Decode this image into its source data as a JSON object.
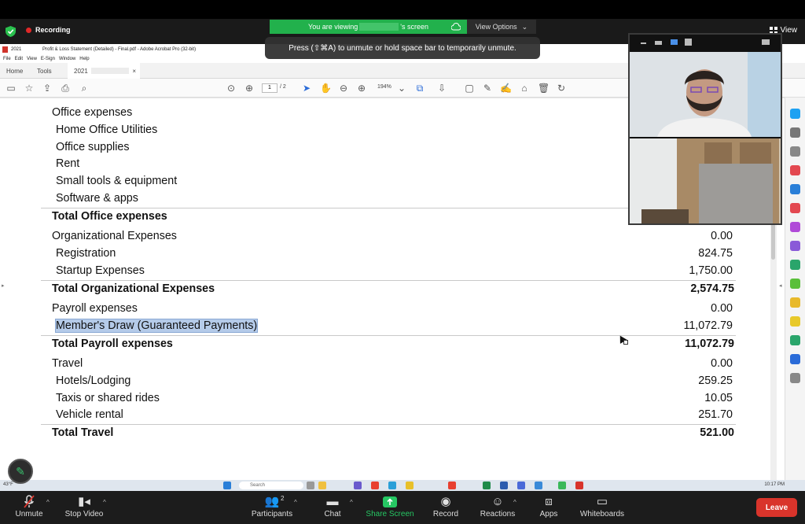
{
  "zoom_top": {
    "recording_label": "Recording",
    "viewing_prefix": "You are viewing",
    "viewing_suffix": "'s screen",
    "view_options_label": "View Options",
    "view_label": "View",
    "unmute_hint": "Press  (⇧⌘A) to unmute or hold space bar to temporarily unmute."
  },
  "acrobat": {
    "window_year": "2021",
    "window_title": "Profit & Loss Statement (Detailed) - Final.pdf - Adobe Acrobat Pro (32-bit)",
    "menu": [
      "File",
      "Edit",
      "View",
      "E-Sign",
      "Window",
      "Help"
    ],
    "tab_home": "Home",
    "tab_tools": "Tools",
    "tab_doc": "2021",
    "tab_close": "×",
    "page_current": "1",
    "page_total": "/ 2",
    "zoom_percent": "194%"
  },
  "statement": {
    "rows": [
      {
        "label": "Office expenses",
        "amount": "",
        "type": "header"
      },
      {
        "label": "Home Office Utilities",
        "amount": "",
        "type": "item"
      },
      {
        "label": "Office supplies",
        "amount": "",
        "type": "item"
      },
      {
        "label": "Rent",
        "amount": "",
        "type": "item"
      },
      {
        "label": "Small tools & equipment",
        "amount": "",
        "type": "item"
      },
      {
        "label": "Software & apps",
        "amount": "",
        "type": "item"
      },
      {
        "label": "Total Office expenses",
        "amount": "",
        "type": "total"
      },
      {
        "label": "Organizational Expenses",
        "amount": "0.00",
        "type": "header"
      },
      {
        "label": "Registration",
        "amount": "824.75",
        "type": "item"
      },
      {
        "label": "Startup Expenses",
        "amount": "1,750.00",
        "type": "item"
      },
      {
        "label": "Total Organizational Expenses",
        "amount": "2,574.75",
        "type": "total"
      },
      {
        "label": "Payroll expenses",
        "amount": "0.00",
        "type": "header"
      },
      {
        "label": "Member's Draw (Guaranteed Payments)",
        "amount": "11,072.79",
        "type": "item",
        "highlighted": true
      },
      {
        "label": "Total Payroll expenses",
        "amount": "11,072.79",
        "type": "total"
      },
      {
        "label": "Travel",
        "amount": "0.00",
        "type": "header"
      },
      {
        "label": "Hotels/Lodging",
        "amount": "259.25",
        "type": "item"
      },
      {
        "label": "Taxis or shared rides",
        "amount": "10.05",
        "type": "item"
      },
      {
        "label": "Vehicle rental",
        "amount": "251.70",
        "type": "item"
      },
      {
        "label": "Total Travel",
        "amount": "521.00",
        "type": "total"
      }
    ]
  },
  "taskbar": {
    "temperature": "43°F",
    "search_placeholder": "Search",
    "clock": "10:17 PM"
  },
  "controls": {
    "unmute": "Unmute",
    "stop_video": "Stop Video",
    "participants": "Participants",
    "participants_count": "2",
    "chat": "Chat",
    "share_screen": "Share Screen",
    "record": "Record",
    "reactions": "Reactions",
    "apps": "Apps",
    "whiteboards": "Whiteboards",
    "leave": "Leave"
  },
  "colors": {
    "share_green": "#26c763",
    "leave_red": "#d9342b",
    "viewing_bar": "#22b14c",
    "highlight": "#b5cbe9"
  }
}
